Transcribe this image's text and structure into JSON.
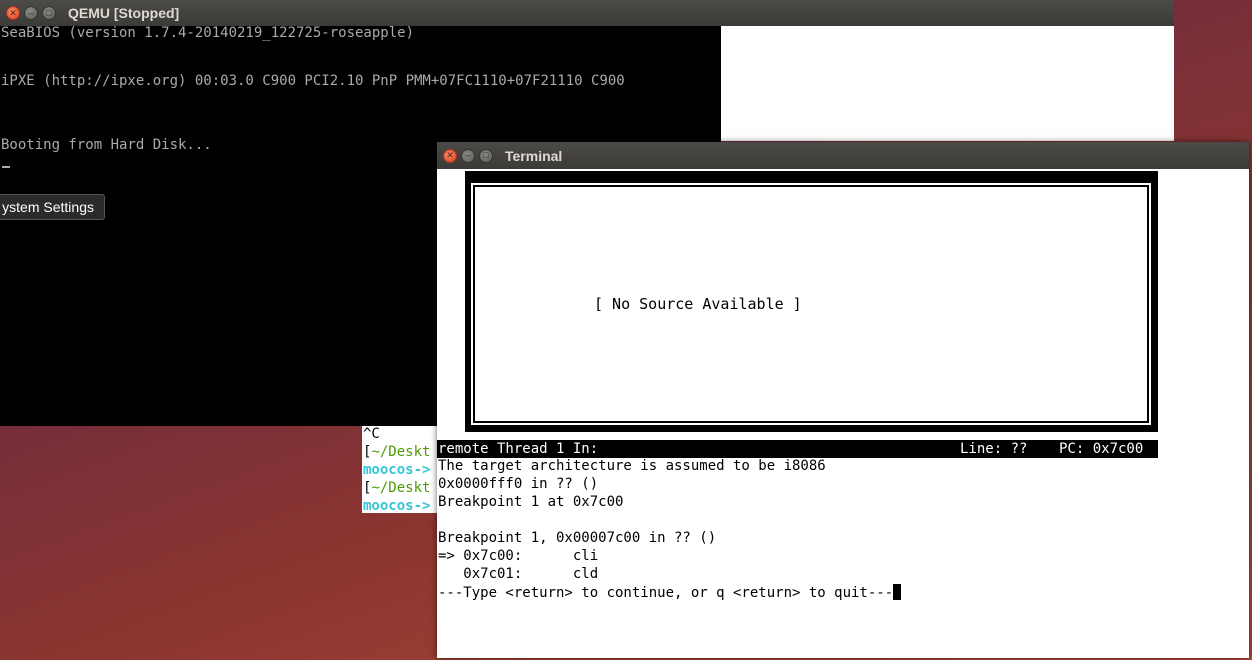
{
  "bg_window": {
    "title": ""
  },
  "qemu": {
    "title": "QEMU [Stopped]",
    "lines": [
      "SeaBIOS (version 1.7.4-20140219_122725-roseapple)",
      "iPXE (http://ipxe.org) 00:03.0 C900 PCI2.10 PnP PMM+07FC1110+07F21110 C900",
      "Booting from Hard Disk..."
    ]
  },
  "tooltip": {
    "label": "ystem Settings"
  },
  "bg_terminal": {
    "line0": "^C",
    "line1_bracket": "[",
    "line1_path": "~/Deskt",
    "line2_prompt": "moocos->",
    "line3_bracket": "[",
    "line3_path": "~/Deskt",
    "line4_prompt": "moocos->"
  },
  "terminal": {
    "title": "Terminal",
    "source_message": "[ No Source Available ]",
    "status_left": "remote Thread 1 In:",
    "status_line": "Line: ??",
    "status_pc": "PC: 0x7c00",
    "output": [
      "The target architecture is assumed to be i8086",
      "0x0000fff0 in ?? ()",
      "Breakpoint 1 at 0x7c00",
      "",
      "Breakpoint 1, 0x00007c00 in ?? ()",
      "=> 0x7c00:      cli",
      "   0x7c01:      cld"
    ],
    "prompt": "---Type <return> to continue, or q <return> to quit---"
  },
  "colors": {
    "path_green": "#4e9a06",
    "prompt_cyan": "#34c6d6",
    "arrow_yellow": "#c4a000"
  }
}
